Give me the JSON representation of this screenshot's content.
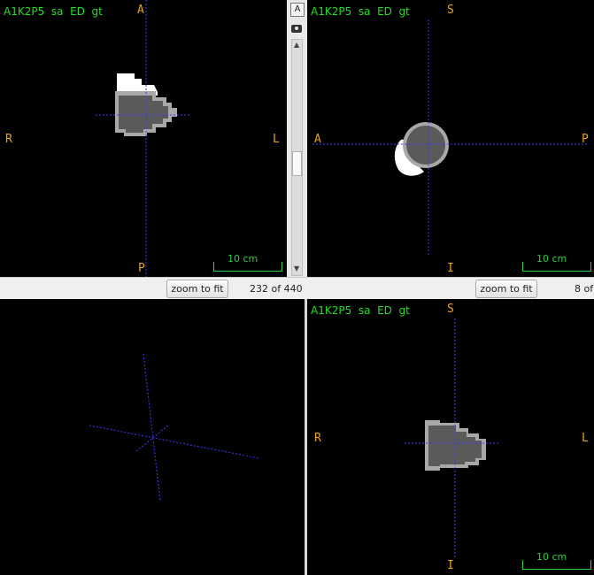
{
  "views": {
    "axial": {
      "title": "A1K2P5  sa  ED  gt",
      "orientation": {
        "top": "A",
        "bottom": "P",
        "left": "R",
        "right": "L"
      },
      "scale_label": "10 cm",
      "zoom_button": "zoom to fit",
      "slice_label": "232 of 440"
    },
    "sagittal": {
      "title": "A1K2P5  sa  ED  gt",
      "orientation": {
        "top": "S",
        "bottom": "I",
        "left": "A",
        "right": "P"
      },
      "scale_label": "10 cm",
      "zoom_button": "zoom to fit",
      "slice_label": "8 of"
    },
    "coronal": {
      "title": "A1K2P5  sa  ED  gt",
      "orientation": {
        "top": "S",
        "bottom": "I",
        "left": "R",
        "right": "L"
      },
      "scale_label": "10 cm"
    }
  },
  "toolbar": {
    "annotation_icon_glyph": "A",
    "icons": [
      "annotation-icon",
      "camera-icon"
    ]
  },
  "colors": {
    "title_text": "#22dd22",
    "orientation_text": "#e8a21a",
    "scale_bar": "#2ecc40",
    "crosshair": "#3b3bff",
    "tissue_dark": "#5a5a5a",
    "tissue_light": "#a8a8a8"
  }
}
